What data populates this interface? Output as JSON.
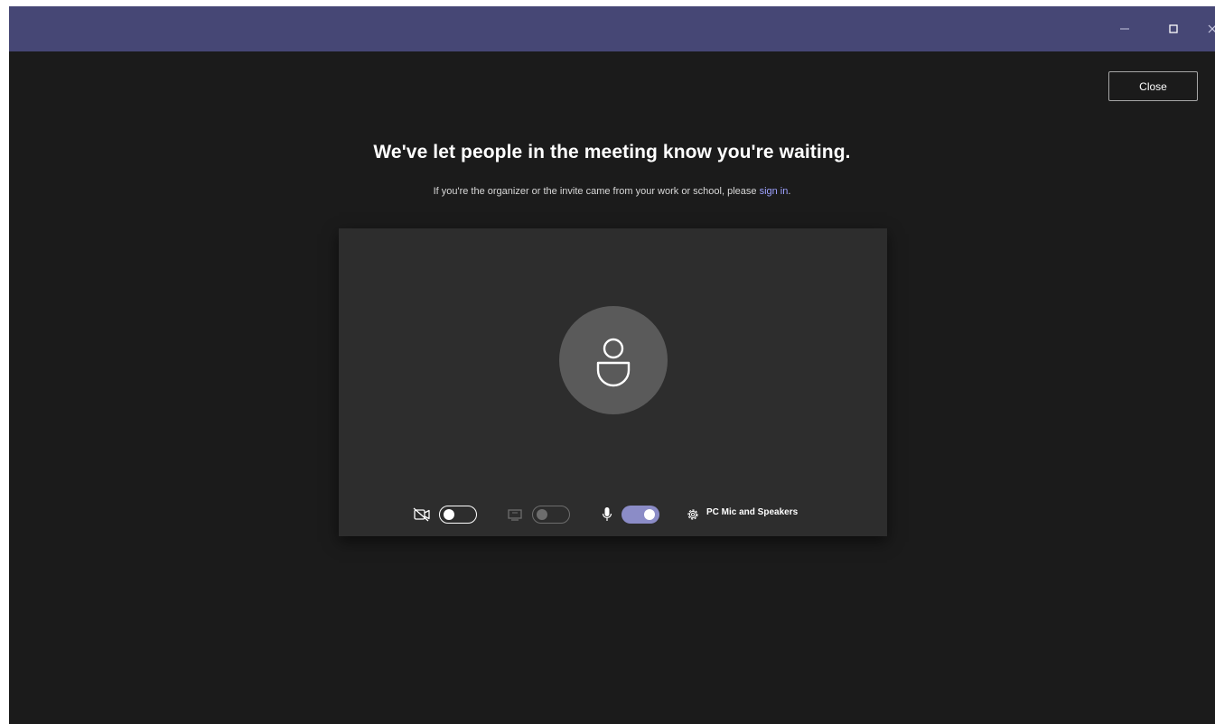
{
  "titlebar": {
    "minimize_icon": "minimize-icon",
    "maximize_icon": "maximize-icon",
    "close_icon": "close-icon",
    "color": "#464775"
  },
  "close_button": {
    "label": "Close"
  },
  "message": {
    "headline": "We've let people in the meeting know you're waiting.",
    "subline_prefix": "If you're the organizer or the invite came from your work or school, please ",
    "sign_in_link": "sign in",
    "subline_suffix": "."
  },
  "preview": {
    "avatar_icon": "person-icon",
    "controls": {
      "camera": {
        "icon": "camera-off-icon",
        "state": "off"
      },
      "background_effects": {
        "icon": "background-effects-icon",
        "state": "disabled"
      },
      "microphone": {
        "icon": "microphone-icon",
        "state": "on"
      },
      "device_settings_icon": "gear-icon",
      "device_label": "PC Mic and Speakers"
    }
  },
  "colors": {
    "background": "#1b1b1b",
    "card": "#2d2d2d",
    "accent": "#8b8cc7",
    "link": "#9ea2ff"
  }
}
